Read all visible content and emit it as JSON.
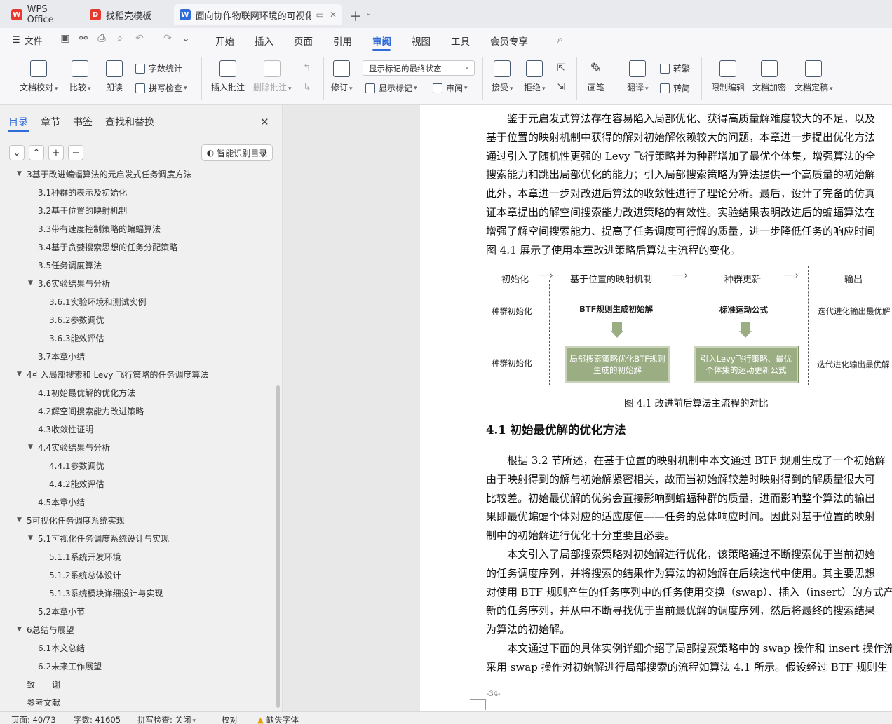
{
  "tabs": [
    {
      "label": "WPS Office",
      "icon": "wps-logo-icon",
      "color": "#e8392f"
    },
    {
      "label": "找稻壳模板",
      "icon": "docer-logo-icon",
      "color": "#e8392f"
    },
    {
      "label": "面向协作物联网环境的可视化任",
      "icon": "writer-logo-icon",
      "color": "#2f6bd9"
    }
  ],
  "menu": {
    "file": "文件",
    "items": [
      "开始",
      "插入",
      "页面",
      "引用",
      "审阅",
      "视图",
      "工具",
      "会员专享"
    ],
    "active": "审阅"
  },
  "ribbon": {
    "doc_check": "文档校对",
    "compare": "比较",
    "read_aloud": "朗读",
    "word_count": "字数统计",
    "spell_check": "拼写检查",
    "insert_comment": "插入批注",
    "delete_comment": "删除批注",
    "revise": "修订",
    "markup_select": "显示标记的最终状态",
    "show_markup": "显示标记",
    "review_pane": "审阅",
    "accept": "接受",
    "reject": "拒绝",
    "pen": "画笔",
    "translate": "翻译",
    "to_traditional": "转繁",
    "to_simplified": "转简",
    "restrict_edit": "限制编辑",
    "encrypt": "文档加密",
    "finalize": "文档定稿"
  },
  "nav": {
    "tabs": [
      "目录",
      "章节",
      "书签",
      "查找和替换"
    ],
    "active_tab": "目录",
    "smart_toc": "智能识别目录",
    "toc": [
      {
        "text": "3基于改进蝙蝠算法的元启发式任务调度方法",
        "level": 1,
        "expanded": true
      },
      {
        "text": "3.1种群的表示及初始化",
        "level": 2
      },
      {
        "text": "3.2基于位置的映射机制",
        "level": 2
      },
      {
        "text": "3.3带有速度控制策略的蝙蝠算法",
        "level": 2
      },
      {
        "text": "3.4基于贪婪搜索思想的任务分配策略",
        "level": 2
      },
      {
        "text": "3.5任务调度算法",
        "level": 2
      },
      {
        "text": "3.6实验结果与分析",
        "level": 2,
        "expanded": true
      },
      {
        "text": "3.6.1实验环境和测试实例",
        "level": 3
      },
      {
        "text": "3.6.2参数调优",
        "level": 3
      },
      {
        "text": "3.6.3能效评估",
        "level": 3
      },
      {
        "text": "3.7本章小结",
        "level": 2
      },
      {
        "text": "4引入局部搜索和 Levy 飞行策略的任务调度算法",
        "level": 1,
        "expanded": true
      },
      {
        "text": "4.1初始最优解的优化方法",
        "level": 2
      },
      {
        "text": "4.2解空间搜索能力改进策略",
        "level": 2
      },
      {
        "text": "4.3收敛性证明",
        "level": 2
      },
      {
        "text": "4.4实验结果与分析",
        "level": 2,
        "expanded": true
      },
      {
        "text": "4.4.1参数调优",
        "level": 3
      },
      {
        "text": "4.4.2能效评估",
        "level": 3
      },
      {
        "text": "4.5本章小结",
        "level": 2
      },
      {
        "text": "5可视化任务调度系统实现",
        "level": 1,
        "expanded": true
      },
      {
        "text": "5.1可视化任务调度系统设计与实现",
        "level": 2,
        "expanded": true
      },
      {
        "text": "5.1.1系统开发环境",
        "level": 3
      },
      {
        "text": "5.1.2系统总体设计",
        "level": 3
      },
      {
        "text": "5.1.3系统模块详细设计与实现",
        "level": 3
      },
      {
        "text": "5.2本章小节",
        "level": 2
      },
      {
        "text": "6总结与展望",
        "level": 1,
        "expanded": true
      },
      {
        "text": "6.1本文总结",
        "level": 2
      },
      {
        "text": "6.2未来工作展望",
        "level": 2
      },
      {
        "text": "致　　谢",
        "level": 1
      },
      {
        "text": "参考文献",
        "level": 1
      }
    ]
  },
  "doc": {
    "para1": [
      "鉴于元启发式算法存在容易陷入局部优化、获得高质量解难度较大的不足，以及",
      "基于位置的映射机制中获得的解对初始解依赖较大的问题，本章进一步提出优化方法",
      "通过引入了随机性更强的 Levy 飞行策略并为种群增加了最优个体集，增强算法的全",
      "搜索能力和跳出局部优化的能力；引入局部搜索策略为算法提供一个高质量的初始解",
      "此外，本章进一步对改进后算法的收敛性进行了理论分析。最后，设计了完备的仿真",
      "证本章提出的解空间搜索能力改进策略的有效性。实验结果表明改进后的蝙蝠算法在",
      "增强了解空间搜索能力、提高了任务调度可行解的质量，进一步降低任务的响应时间",
      "图 4.1 展示了使用本章改进策略后算法主流程的变化。"
    ],
    "figure": {
      "headers": [
        "初始化",
        "基于位置的映射机制",
        "种群更新",
        "输出"
      ],
      "row1": [
        "种群初始化",
        "BTF规则生成初始解",
        "标准运动公式",
        "迭代进化输出最优解"
      ],
      "row2": [
        "种群初始化",
        "局部搜索策略优化BTF规则生成的初始解",
        "引入Levy飞行策略、最优个体集的运动更新公式",
        "迭代进化输出最优解"
      ],
      "arrow_color": "#9bae83"
    },
    "fig_caption": "图 4.1  改进前后算法主流程的对比",
    "heading": "4.1  初始最优解的优化方法",
    "para2": [
      "根据 3.2 节所述，在基于位置的映射机制中本文通过 BTF 规则生成了一个初始解",
      "由于映射得到的解与初始解紧密相关，故而当初始解较差时映射得到的解质量很大可",
      "比较差。初始最优解的优劣会直接影响到蝙蝠种群的质量，进而影响整个算法的输出",
      "果即最优蝙蝠个体对应的适应度值——任务的总体响应时间。因此对基于位置的映射",
      "制中的初始解进行优化十分重要且必要。",
      "本文引入了局部搜索策略对初始解进行优化，该策略通过不断搜索优于当前初始",
      "的任务调度序列，并将搜索的结果作为算法的初始解在后续迭代中使用。其主要思想",
      "对使用 BTF 规则产生的任务序列中的任务使用交换（swap）、插入（insert）的方式产",
      "新的任务序列，并从中不断寻找优于当前最优解的调度序列，然后将最终的搜索结果",
      "为算法的初始解。",
      "本文通过下面的具体实例详细介绍了局部搜索策略中的 swap 操作和 insert 操作流",
      "采用 swap 操作对初始解进行局部搜索的流程如算法 4.1 所示。假设经过 BTF 规则生"
    ],
    "page_number": "-34-"
  },
  "status": {
    "page": "页面: 40/73",
    "words": "字数: 41605",
    "spell": "拼写检查: 关闭",
    "proof": "校对",
    "missing_font": "缺失字体"
  }
}
